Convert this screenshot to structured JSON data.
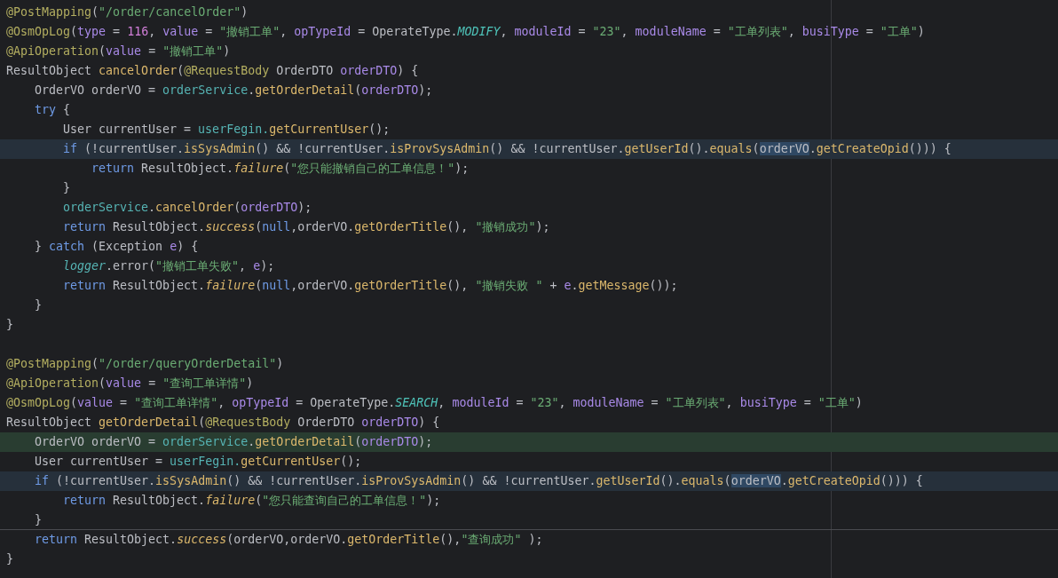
{
  "editor": {
    "lines": [
      {
        "tokens": [
          {
            "text": "@PostMapping",
            "kind": "annotation"
          },
          {
            "text": "(",
            "kind": "plain"
          },
          {
            "text": "\"/order/cancelOrder\"",
            "kind": "string"
          },
          {
            "text": ")",
            "kind": "plain"
          }
        ]
      },
      {
        "tokens": [
          {
            "text": "@OsmOpLog",
            "kind": "annotation"
          },
          {
            "text": "(",
            "kind": "plain"
          },
          {
            "text": "type",
            "kind": "param"
          },
          {
            "text": " = ",
            "kind": "plain"
          },
          {
            "text": "116",
            "kind": "number"
          },
          {
            "text": ", ",
            "kind": "plain"
          },
          {
            "text": "value",
            "kind": "param"
          },
          {
            "text": " = ",
            "kind": "plain"
          },
          {
            "text": "\"撤销工单\"",
            "kind": "string"
          },
          {
            "text": ", ",
            "kind": "plain"
          },
          {
            "text": "opTypeId",
            "kind": "param"
          },
          {
            "text": " = OperateType.",
            "kind": "plain"
          },
          {
            "text": "MODIFY",
            "kind": "constant"
          },
          {
            "text": ", ",
            "kind": "plain"
          },
          {
            "text": "moduleId",
            "kind": "param"
          },
          {
            "text": " = ",
            "kind": "plain"
          },
          {
            "text": "\"23\"",
            "kind": "string"
          },
          {
            "text": ", ",
            "kind": "plain"
          },
          {
            "text": "moduleName",
            "kind": "param"
          },
          {
            "text": " = ",
            "kind": "plain"
          },
          {
            "text": "\"工单列表\"",
            "kind": "string"
          },
          {
            "text": ", ",
            "kind": "plain"
          },
          {
            "text": "busiType",
            "kind": "param"
          },
          {
            "text": " = ",
            "kind": "plain"
          },
          {
            "text": "\"工单\"",
            "kind": "string"
          },
          {
            "text": ")",
            "kind": "plain"
          }
        ]
      },
      {
        "tokens": [
          {
            "text": "@ApiOperation",
            "kind": "annotation"
          },
          {
            "text": "(",
            "kind": "plain"
          },
          {
            "text": "value",
            "kind": "param"
          },
          {
            "text": " = ",
            "kind": "plain"
          },
          {
            "text": "\"撤销工单\"",
            "kind": "string"
          },
          {
            "text": ")",
            "kind": "plain"
          }
        ]
      },
      {
        "tokens": [
          {
            "text": "ResultObject ",
            "kind": "plain"
          },
          {
            "text": "cancelOrder",
            "kind": "method"
          },
          {
            "text": "(",
            "kind": "plain"
          },
          {
            "text": "@RequestBody",
            "kind": "annotation"
          },
          {
            "text": " OrderDTO ",
            "kind": "plain"
          },
          {
            "text": "orderDTO",
            "kind": "param"
          },
          {
            "text": ") {",
            "kind": "plain"
          }
        ],
        "children": [
          {
            "tokens": [
              {
                "text": "OrderVO orderVO = ",
                "kind": "plain"
              },
              {
                "text": "orderService",
                "kind": "field"
              },
              {
                "text": ".",
                "kind": "plain"
              },
              {
                "text": "getOrderDetail",
                "kind": "method"
              },
              {
                "text": "(",
                "kind": "plain"
              },
              {
                "text": "orderDTO",
                "kind": "param"
              },
              {
                "text": ");",
                "kind": "plain"
              }
            ]
          },
          {
            "tokens": [
              {
                "text": "try",
                "kind": "keyword"
              },
              {
                "text": " {",
                "kind": "plain"
              }
            ],
            "children": [
              {
                "tokens": [
                  {
                    "text": "User currentUser = ",
                    "kind": "plain"
                  },
                  {
                    "text": "userFegin.",
                    "kind": "field"
                  },
                  {
                    "text": "getCurrentUser",
                    "kind": "method"
                  },
                  {
                    "text": "();",
                    "kind": "plain"
                  }
                ]
              },
              {
                "current": true,
                "tokens": [
                  {
                    "text": "if",
                    "kind": "keyword"
                  },
                  {
                    "text": " (!currentUser.",
                    "kind": "plain"
                  },
                  {
                    "text": "isSysAdmin",
                    "kind": "method"
                  },
                  {
                    "text": "() && !currentUser.",
                    "kind": "plain"
                  },
                  {
                    "text": "isProvSysAdmin",
                    "kind": "method"
                  },
                  {
                    "text": "() && !currentUser.",
                    "kind": "plain"
                  },
                  {
                    "text": "getUserId",
                    "kind": "method"
                  },
                  {
                    "text": "().",
                    "kind": "plain"
                  },
                  {
                    "text": "equals",
                    "kind": "method"
                  },
                  {
                    "text": "(",
                    "kind": "plain"
                  },
                  {
                    "text": "orderVO",
                    "kind": "plain",
                    "marked": true
                  },
                  {
                    "text": ".",
                    "kind": "plain"
                  },
                  {
                    "text": "getCreateOpid",
                    "kind": "method"
                  },
                  {
                    "text": "())) {",
                    "kind": "plain"
                  }
                ],
                "children": [
                  {
                    "tokens": [
                      {
                        "text": "return",
                        "kind": "keyword"
                      },
                      {
                        "text": " ResultObject.",
                        "kind": "plain"
                      },
                      {
                        "text": "failure",
                        "kind": "static"
                      },
                      {
                        "text": "(",
                        "kind": "plain"
                      },
                      {
                        "text": "\"您只能撤销自己的工单信息！\"",
                        "kind": "string"
                      },
                      {
                        "text": ");",
                        "kind": "plain"
                      }
                    ]
                  }
                ]
              },
              {
                "tokens": [
                  {
                    "text": "}",
                    "kind": "plain"
                  }
                ]
              },
              {
                "tokens": [
                  {
                    "text": "orderService",
                    "kind": "field"
                  },
                  {
                    "text": ".",
                    "kind": "plain"
                  },
                  {
                    "text": "cancelOrder",
                    "kind": "method"
                  },
                  {
                    "text": "(",
                    "kind": "plain"
                  },
                  {
                    "text": "orderDTO",
                    "kind": "param"
                  },
                  {
                    "text": ");",
                    "kind": "plain"
                  }
                ]
              },
              {
                "tokens": [
                  {
                    "text": "return",
                    "kind": "keyword"
                  },
                  {
                    "text": " ResultObject.",
                    "kind": "plain"
                  },
                  {
                    "text": "success",
                    "kind": "static"
                  },
                  {
                    "text": "(",
                    "kind": "plain"
                  },
                  {
                    "text": "null",
                    "kind": "keyword"
                  },
                  {
                    "text": ",orderVO.",
                    "kind": "plain"
                  },
                  {
                    "text": "getOrderTitle",
                    "kind": "method"
                  },
                  {
                    "text": "(), ",
                    "kind": "plain"
                  },
                  {
                    "text": "\"撤销成功\"",
                    "kind": "string"
                  },
                  {
                    "text": ");",
                    "kind": "plain"
                  }
                ]
              }
            ]
          },
          {
            "tokens": [
              {
                "text": "} ",
                "kind": "plain"
              },
              {
                "text": "catch",
                "kind": "keyword"
              },
              {
                "text": " (Exception ",
                "kind": "plain"
              },
              {
                "text": "e",
                "kind": "param"
              },
              {
                "text": ") {",
                "kind": "plain"
              }
            ],
            "children": [
              {
                "tokens": [
                  {
                    "text": "logger",
                    "kind": "static-field"
                  },
                  {
                    "text": ".error(",
                    "kind": "plain"
                  },
                  {
                    "text": "\"撤销工单失败\"",
                    "kind": "string"
                  },
                  {
                    "text": ", ",
                    "kind": "plain"
                  },
                  {
                    "text": "e",
                    "kind": "param"
                  },
                  {
                    "text": ");",
                    "kind": "plain"
                  }
                ]
              },
              {
                "tokens": [
                  {
                    "text": "return",
                    "kind": "keyword"
                  },
                  {
                    "text": " ResultObject.",
                    "kind": "plain"
                  },
                  {
                    "text": "failure",
                    "kind": "static"
                  },
                  {
                    "text": "(",
                    "kind": "plain"
                  },
                  {
                    "text": "null",
                    "kind": "keyword"
                  },
                  {
                    "text": ",orderVO.",
                    "kind": "plain"
                  },
                  {
                    "text": "getOrderTitle",
                    "kind": "method"
                  },
                  {
                    "text": "(), ",
                    "kind": "plain"
                  },
                  {
                    "text": "\"撤销失败 \"",
                    "kind": "string"
                  },
                  {
                    "text": " + ",
                    "kind": "plain"
                  },
                  {
                    "text": "e",
                    "kind": "param"
                  },
                  {
                    "text": ".",
                    "kind": "plain"
                  },
                  {
                    "text": "getMessage",
                    "kind": "method"
                  },
                  {
                    "text": "());",
                    "kind": "plain"
                  }
                ]
              }
            ]
          },
          {
            "tokens": [
              {
                "text": "}",
                "kind": "plain"
              }
            ]
          }
        ]
      },
      {
        "tokens": [
          {
            "text": "}",
            "kind": "plain"
          }
        ]
      },
      {
        "gap_before": true,
        "tokens": [
          {
            "text": "@PostMapping",
            "kind": "annotation"
          },
          {
            "text": "(",
            "kind": "plain"
          },
          {
            "text": "\"/order/queryOrderDetail\"",
            "kind": "string"
          },
          {
            "text": ")",
            "kind": "plain"
          }
        ]
      },
      {
        "tokens": [
          {
            "text": "@ApiOperation",
            "kind": "annotation"
          },
          {
            "text": "(",
            "kind": "plain"
          },
          {
            "text": "value",
            "kind": "param"
          },
          {
            "text": " = ",
            "kind": "plain"
          },
          {
            "text": "\"查询工单详情\"",
            "kind": "string"
          },
          {
            "text": ")",
            "kind": "plain"
          }
        ]
      },
      {
        "tokens": [
          {
            "text": "@OsmOpLog",
            "kind": "annotation"
          },
          {
            "text": "(",
            "kind": "plain"
          },
          {
            "text": "value",
            "kind": "param"
          },
          {
            "text": " = ",
            "kind": "plain"
          },
          {
            "text": "\"查询工单详情\"",
            "kind": "string"
          },
          {
            "text": ", ",
            "kind": "plain"
          },
          {
            "text": "opTypeId",
            "kind": "param"
          },
          {
            "text": " = OperateType.",
            "kind": "plain"
          },
          {
            "text": "SEARCH",
            "kind": "constant"
          },
          {
            "text": ", ",
            "kind": "plain"
          },
          {
            "text": "moduleId",
            "kind": "param"
          },
          {
            "text": " = ",
            "kind": "plain"
          },
          {
            "text": "\"23\"",
            "kind": "string"
          },
          {
            "text": ", ",
            "kind": "plain"
          },
          {
            "text": "moduleName",
            "kind": "param"
          },
          {
            "text": " = ",
            "kind": "plain"
          },
          {
            "text": "\"工单列表\"",
            "kind": "string"
          },
          {
            "text": ", ",
            "kind": "plain"
          },
          {
            "text": "busiType",
            "kind": "param"
          },
          {
            "text": " = ",
            "kind": "plain"
          },
          {
            "text": "\"工单\"",
            "kind": "string"
          },
          {
            "text": ")",
            "kind": "plain"
          }
        ]
      },
      {
        "tokens": [
          {
            "text": "ResultObject ",
            "kind": "plain"
          },
          {
            "text": "getOrderDetail",
            "kind": "method"
          },
          {
            "text": "(",
            "kind": "plain"
          },
          {
            "text": "@RequestBody",
            "kind": "annotation"
          },
          {
            "text": " OrderDTO ",
            "kind": "plain"
          },
          {
            "text": "orderDTO",
            "kind": "param"
          },
          {
            "text": ") {",
            "kind": "plain"
          }
        ],
        "children": [
          {
            "added": true,
            "tokens": [
              {
                "text": "OrderVO orderVO = ",
                "kind": "plain"
              },
              {
                "text": "orderService",
                "kind": "field"
              },
              {
                "text": ".",
                "kind": "plain"
              },
              {
                "text": "getOrderDetail",
                "kind": "method"
              },
              {
                "text": "(",
                "kind": "plain"
              },
              {
                "text": "orderDTO",
                "kind": "param"
              },
              {
                "text": ");",
                "kind": "plain"
              }
            ]
          },
          {
            "tokens": [
              {
                "text": "User currentUser = ",
                "kind": "plain"
              },
              {
                "text": "userFegin.",
                "kind": "field"
              },
              {
                "text": "getCurrentUser",
                "kind": "method"
              },
              {
                "text": "();",
                "kind": "plain"
              }
            ]
          },
          {
            "current": true,
            "tokens": [
              {
                "text": "if",
                "kind": "keyword"
              },
              {
                "text": " (!currentUser.",
                "kind": "plain"
              },
              {
                "text": "isSysAdmin",
                "kind": "method"
              },
              {
                "text": "() && !currentUser.",
                "kind": "plain"
              },
              {
                "text": "isProvSysAdmin",
                "kind": "method"
              },
              {
                "text": "() && !currentUser.",
                "kind": "plain"
              },
              {
                "text": "getUserId",
                "kind": "method"
              },
              {
                "text": "().",
                "kind": "plain"
              },
              {
                "text": "equals",
                "kind": "method"
              },
              {
                "text": "(",
                "kind": "plain"
              },
              {
                "text": "orderVO",
                "kind": "plain",
                "marked": true
              },
              {
                "text": ".",
                "kind": "plain"
              },
              {
                "text": "getCreateOpid",
                "kind": "method"
              },
              {
                "text": "())) {",
                "kind": "plain"
              }
            ],
            "children": [
              {
                "tokens": [
                  {
                    "text": "return",
                    "kind": "keyword"
                  },
                  {
                    "text": " ResultObject.",
                    "kind": "plain"
                  },
                  {
                    "text": "failure",
                    "kind": "static"
                  },
                  {
                    "text": "(",
                    "kind": "plain"
                  },
                  {
                    "text": "\"您只能查询自己的工单信息！\"",
                    "kind": "string"
                  },
                  {
                    "text": ");",
                    "kind": "plain"
                  }
                ]
              }
            ]
          },
          {
            "separator": true,
            "tokens": [
              {
                "text": "}",
                "kind": "plain"
              }
            ]
          },
          {
            "tokens": [
              {
                "text": "return",
                "kind": "keyword"
              },
              {
                "text": " ResultObject.",
                "kind": "plain"
              },
              {
                "text": "success",
                "kind": "static"
              },
              {
                "text": "(orderVO,orderVO.",
                "kind": "plain"
              },
              {
                "text": "getOrderTitle",
                "kind": "method"
              },
              {
                "text": "(),",
                "kind": "plain"
              },
              {
                "text": "\"查询成功\"",
                "kind": "string"
              },
              {
                "text": " );",
                "kind": "plain"
              }
            ]
          }
        ]
      },
      {
        "tokens": [
          {
            "text": "}",
            "kind": "plain"
          }
        ]
      }
    ]
  }
}
